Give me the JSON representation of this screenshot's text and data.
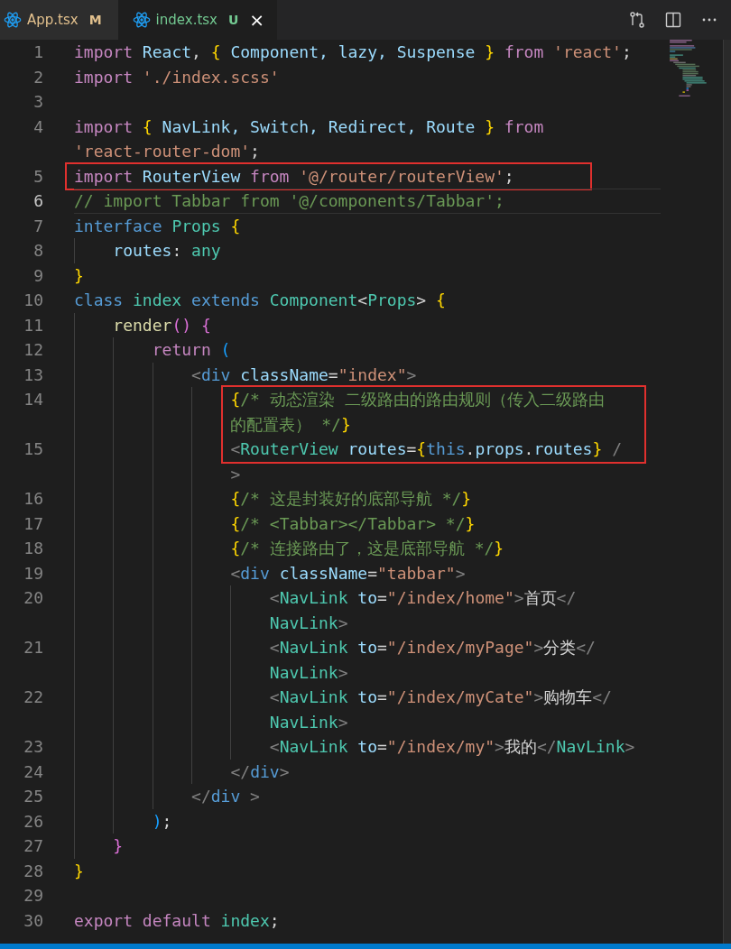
{
  "tabs": [
    {
      "label": "App.tsx",
      "badge": "M",
      "selected": false,
      "closable": false
    },
    {
      "label": "index.tsx",
      "badge": "U",
      "selected": true,
      "closable": true,
      "close": "×"
    }
  ],
  "lines": [
    {
      "n": "1",
      "current": false,
      "rows": [
        {
          "boxed": false,
          "t": [
            {
              "text": "import",
              "kind": "kw"
            },
            {
              "text": " React",
              "kind": "var"
            },
            {
              "text": ", ",
              "kind": "plain"
            },
            {
              "text": "{",
              "kind": "br1"
            },
            {
              "text": " Component, lazy, Suspense ",
              "kind": "var"
            },
            {
              "text": "}",
              "kind": "br1"
            },
            {
              "text": " from",
              "kind": "kw"
            },
            {
              "text": " 'react'",
              "kind": "str"
            },
            {
              "text": ";",
              "kind": "plain"
            }
          ]
        }
      ]
    },
    {
      "n": "2",
      "current": false,
      "rows": [
        {
          "boxed": false,
          "t": [
            {
              "text": "import",
              "kind": "kw"
            },
            {
              "text": " './index.scss'",
              "kind": "str"
            }
          ]
        }
      ]
    },
    {
      "n": "3",
      "current": false
    },
    {
      "n": "4",
      "current": false,
      "rows": [
        {
          "boxed": false,
          "t": [
            {
              "text": "import",
              "kind": "kw"
            },
            {
              "text": " {",
              "kind": "br1"
            },
            {
              "text": " NavLink, Switch, Redirect, Route ",
              "kind": "var"
            },
            {
              "text": "}",
              "kind": "br1"
            },
            {
              "text": " from",
              "kind": "kw"
            }
          ]
        },
        {
          "boxed": false,
          "t": [
            {
              "text": "'react-router-dom'",
              "kind": "str"
            },
            {
              "text": ";",
              "kind": "plain"
            }
          ]
        }
      ]
    },
    {
      "n": "5",
      "current": false,
      "rows": [
        {
          "boxed": true,
          "t": [
            {
              "text": "import",
              "kind": "kw"
            },
            {
              "text": " RouterView",
              "kind": "var"
            },
            {
              "text": " from",
              "kind": "kw"
            },
            {
              "text": " '@/router/routerView'",
              "kind": "str"
            },
            {
              "text": ";",
              "kind": "plain"
            }
          ]
        }
      ]
    },
    {
      "n": "6",
      "current": true,
      "rows": [
        {
          "boxed": false,
          "t": [
            {
              "text": "// import Tabbar from '@/components/Tabbar';",
              "kind": "com"
            }
          ]
        }
      ]
    },
    {
      "n": "7",
      "current": false,
      "rows": [
        {
          "boxed": false,
          "t": [
            {
              "text": "interface",
              "kind": "kw2"
            },
            {
              "text": " Props ",
              "kind": "type"
            },
            {
              "text": "{",
              "kind": "br1"
            }
          ]
        }
      ]
    },
    {
      "n": "8",
      "current": false,
      "rows": [
        {
          "boxed": false,
          "t": [
            {
              "text": "    routes",
              "kind": "var"
            },
            {
              "text": ": ",
              "kind": "plain"
            },
            {
              "text": "any",
              "kind": "type"
            }
          ]
        }
      ]
    },
    {
      "n": "9",
      "current": false,
      "rows": [
        {
          "boxed": false,
          "t": [
            {
              "text": "}",
              "kind": "br1"
            }
          ]
        }
      ]
    },
    {
      "n": "10",
      "current": false,
      "rows": [
        {
          "boxed": false,
          "t": [
            {
              "text": "class",
              "kind": "kw2"
            },
            {
              "text": " index",
              "kind": "type"
            },
            {
              "text": " extends",
              "kind": "kw2"
            },
            {
              "text": " Component",
              "kind": "type"
            },
            {
              "text": "<",
              "kind": "plain"
            },
            {
              "text": "Props",
              "kind": "type"
            },
            {
              "text": "> ",
              "kind": "plain"
            },
            {
              "text": "{",
              "kind": "br1"
            }
          ]
        }
      ]
    },
    {
      "n": "11",
      "current": false,
      "rows": [
        {
          "boxed": false,
          "t": [
            {
              "text": "    render",
              "kind": "fn"
            },
            {
              "text": "()",
              "kind": "br2"
            },
            {
              "text": " {",
              "kind": "br2"
            }
          ]
        }
      ]
    },
    {
      "n": "12",
      "current": false,
      "rows": [
        {
          "boxed": false,
          "t": [
            {
              "text": "        return",
              "kind": "kw"
            },
            {
              "text": " (",
              "kind": "br3"
            }
          ]
        }
      ]
    },
    {
      "n": "13",
      "current": false,
      "rows": [
        {
          "boxed": false,
          "t": [
            {
              "text": "            <",
              "kind": "tag"
            },
            {
              "text": "div",
              "kind": "kw2"
            },
            {
              "text": " className",
              "kind": "var"
            },
            {
              "text": "=",
              "kind": "plain"
            },
            {
              "text": "\"index\"",
              "kind": "str"
            },
            {
              "text": ">",
              "kind": "tag"
            }
          ]
        }
      ]
    },
    {
      "n": "14",
      "current": false,
      "rows": [
        {
          "boxed": true,
          "t": [
            {
              "text": "                {",
              "kind": "br1"
            },
            {
              "text": "/* 动态渲染 二级路由的路由规则（传入二级路由",
              "kind": "com"
            }
          ]
        },
        {
          "boxed": true,
          "t": [
            {
              "text": "                的配置表） */",
              "kind": "com"
            },
            {
              "text": "}",
              "kind": "br1"
            }
          ]
        }
      ]
    },
    {
      "n": "15",
      "current": false,
      "rows": [
        {
          "boxed": true,
          "t": [
            {
              "text": "                <",
              "kind": "tag"
            },
            {
              "text": "RouterView",
              "kind": "type"
            },
            {
              "text": " routes",
              "kind": "var"
            },
            {
              "text": "=",
              "kind": "plain"
            },
            {
              "text": "{",
              "kind": "br1"
            },
            {
              "text": "this",
              "kind": "kw2"
            },
            {
              "text": ".",
              "kind": "plain"
            },
            {
              "text": "props",
              "kind": "var"
            },
            {
              "text": ".",
              "kind": "plain"
            },
            {
              "text": "routes",
              "kind": "var"
            },
            {
              "text": "}",
              "kind": "br1"
            },
            {
              "text": " /",
              "kind": "tag"
            }
          ]
        },
        {
          "boxed": false,
          "t": [
            {
              "text": "                >",
              "kind": "tag"
            }
          ]
        }
      ]
    },
    {
      "n": "16",
      "current": false,
      "rows": [
        {
          "boxed": false,
          "t": [
            {
              "text": "                {",
              "kind": "br1"
            },
            {
              "text": "/* 这是封装好的底部导航 */",
              "kind": "com"
            },
            {
              "text": "}",
              "kind": "br1"
            }
          ]
        }
      ]
    },
    {
      "n": "17",
      "current": false,
      "rows": [
        {
          "boxed": false,
          "t": [
            {
              "text": "                {",
              "kind": "br1"
            },
            {
              "text": "/* <Tabbar></Tabbar> */",
              "kind": "com"
            },
            {
              "text": "}",
              "kind": "br1"
            }
          ]
        }
      ]
    },
    {
      "n": "18",
      "current": false,
      "rows": [
        {
          "boxed": false,
          "t": [
            {
              "text": "                {",
              "kind": "br1"
            },
            {
              "text": "/* 连接路由了，这是底部导航 */",
              "kind": "com"
            },
            {
              "text": "}",
              "kind": "br1"
            }
          ]
        }
      ]
    },
    {
      "n": "19",
      "current": false,
      "rows": [
        {
          "boxed": false,
          "t": [
            {
              "text": "                <",
              "kind": "tag"
            },
            {
              "text": "div",
              "kind": "kw2"
            },
            {
              "text": " className",
              "kind": "var"
            },
            {
              "text": "=",
              "kind": "plain"
            },
            {
              "text": "\"tabbar\"",
              "kind": "str"
            },
            {
              "text": ">",
              "kind": "tag"
            }
          ]
        }
      ]
    },
    {
      "n": "20",
      "current": false,
      "rows": [
        {
          "boxed": false,
          "t": [
            {
              "text": "                    <",
              "kind": "tag"
            },
            {
              "text": "NavLink",
              "kind": "type"
            },
            {
              "text": " to",
              "kind": "var"
            },
            {
              "text": "=",
              "kind": "plain"
            },
            {
              "text": "\"/index/home\"",
              "kind": "str"
            },
            {
              "text": ">",
              "kind": "tag"
            },
            {
              "text": "首页",
              "kind": "plain"
            },
            {
              "text": "</",
              "kind": "tag"
            }
          ]
        },
        {
          "boxed": false,
          "t": [
            {
              "text": "                    NavLink",
              "kind": "type"
            },
            {
              "text": ">",
              "kind": "tag"
            }
          ]
        }
      ]
    },
    {
      "n": "21",
      "current": false,
      "rows": [
        {
          "boxed": false,
          "t": [
            {
              "text": "                    <",
              "kind": "tag"
            },
            {
              "text": "NavLink",
              "kind": "type"
            },
            {
              "text": " to",
              "kind": "var"
            },
            {
              "text": "=",
              "kind": "plain"
            },
            {
              "text": "\"/index/myPage\"",
              "kind": "str"
            },
            {
              "text": ">",
              "kind": "tag"
            },
            {
              "text": "分类",
              "kind": "plain"
            },
            {
              "text": "</",
              "kind": "tag"
            }
          ]
        },
        {
          "boxed": false,
          "t": [
            {
              "text": "                    NavLink",
              "kind": "type"
            },
            {
              "text": ">",
              "kind": "tag"
            }
          ]
        }
      ]
    },
    {
      "n": "22",
      "current": false,
      "rows": [
        {
          "boxed": false,
          "t": [
            {
              "text": "                    <",
              "kind": "tag"
            },
            {
              "text": "NavLink",
              "kind": "type"
            },
            {
              "text": " to",
              "kind": "var"
            },
            {
              "text": "=",
              "kind": "plain"
            },
            {
              "text": "\"/index/myCate\"",
              "kind": "str"
            },
            {
              "text": ">",
              "kind": "tag"
            },
            {
              "text": "购物车",
              "kind": "plain"
            },
            {
              "text": "</",
              "kind": "tag"
            }
          ]
        },
        {
          "boxed": false,
          "t": [
            {
              "text": "                    NavLink",
              "kind": "type"
            },
            {
              "text": ">",
              "kind": "tag"
            }
          ]
        }
      ]
    },
    {
      "n": "23",
      "current": false,
      "rows": [
        {
          "boxed": false,
          "t": [
            {
              "text": "                    <",
              "kind": "tag"
            },
            {
              "text": "NavLink",
              "kind": "type"
            },
            {
              "text": " to",
              "kind": "var"
            },
            {
              "text": "=",
              "kind": "plain"
            },
            {
              "text": "\"/index/my\"",
              "kind": "str"
            },
            {
              "text": ">",
              "kind": "tag"
            },
            {
              "text": "我的",
              "kind": "plain"
            },
            {
              "text": "</",
              "kind": "tag"
            },
            {
              "text": "NavLink",
              "kind": "type"
            },
            {
              "text": ">",
              "kind": "tag"
            }
          ]
        }
      ]
    },
    {
      "n": "24",
      "current": false,
      "rows": [
        {
          "boxed": false,
          "t": [
            {
              "text": "                </",
              "kind": "tag"
            },
            {
              "text": "div",
              "kind": "kw2"
            },
            {
              "text": ">",
              "kind": "tag"
            }
          ]
        }
      ]
    },
    {
      "n": "25",
      "current": false,
      "rows": [
        {
          "boxed": false,
          "t": [
            {
              "text": "            </",
              "kind": "tag"
            },
            {
              "text": "div",
              "kind": "kw2"
            },
            {
              "text": " >",
              "kind": "tag"
            }
          ]
        }
      ]
    },
    {
      "n": "26",
      "current": false,
      "rows": [
        {
          "boxed": false,
          "t": [
            {
              "text": "        )",
              "kind": "br3"
            },
            {
              "text": ";",
              "kind": "plain"
            }
          ]
        }
      ]
    },
    {
      "n": "27",
      "current": false,
      "rows": [
        {
          "boxed": false,
          "t": [
            {
              "text": "    }",
              "kind": "br2"
            }
          ]
        }
      ]
    },
    {
      "n": "28",
      "current": false,
      "rows": [
        {
          "boxed": false,
          "t": [
            {
              "text": "}",
              "kind": "br1"
            }
          ]
        }
      ]
    },
    {
      "n": "29",
      "current": false
    },
    {
      "n": "30",
      "current": false,
      "rows": [
        {
          "boxed": false,
          "t": [
            {
              "text": "export default",
              "kind": "kw"
            },
            {
              "text": " index",
              "kind": "type"
            },
            {
              "text": ";",
              "kind": "plain"
            }
          ]
        }
      ]
    }
  ]
}
